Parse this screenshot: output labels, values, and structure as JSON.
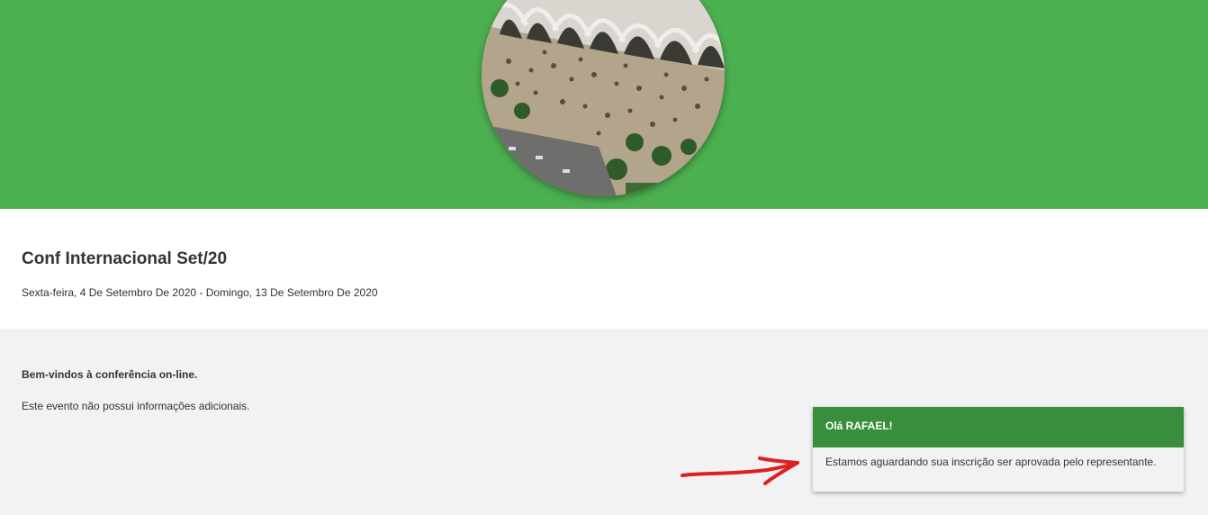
{
  "hero": {
    "background_color": "#4caf50",
    "image": "aerial-photo-of-crowd-at-arched-building"
  },
  "event": {
    "title": "Conf Internacional Set/20",
    "dates": "Sexta-feira, 4 De Setembro De 2020 - Domingo, 13 De Setembro De 2020"
  },
  "content": {
    "welcome": "Bem-vindos à conferência on-line.",
    "no_info": "Este evento não possui informações adicionais."
  },
  "notification": {
    "title": "Olá RAFAEL!",
    "message": "Estamos aguardando sua inscrição ser aprovada pelo representante.",
    "header_color": "#388e3c"
  },
  "annotation": {
    "arrow_color": "#e02020"
  }
}
